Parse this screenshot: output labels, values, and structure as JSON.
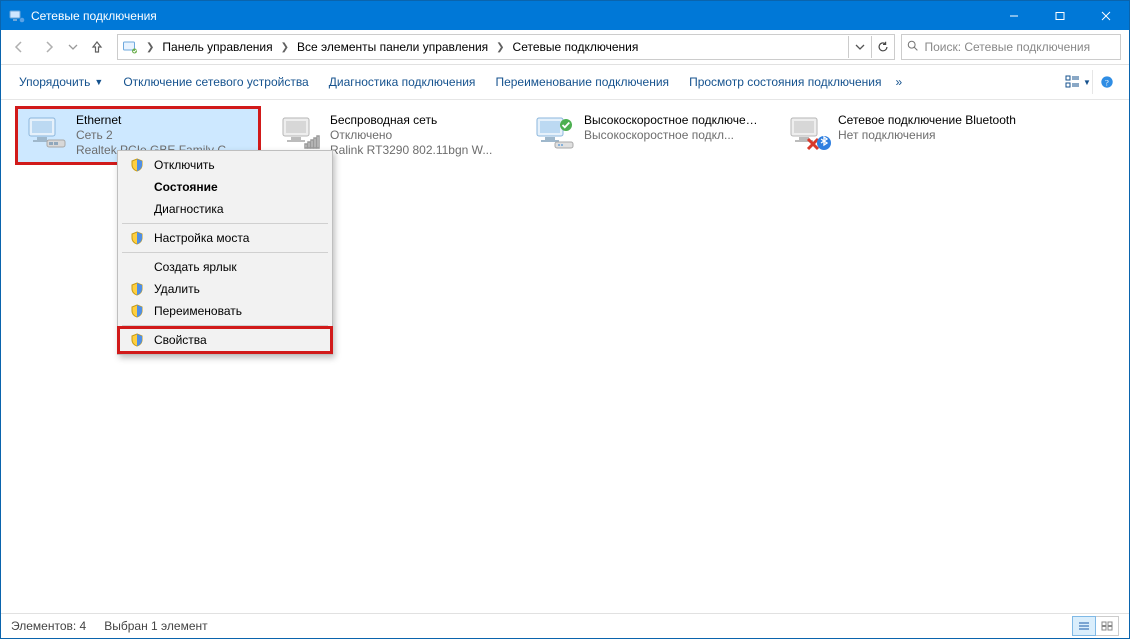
{
  "window": {
    "title": "Сетевые подключения"
  },
  "nav": {
    "back_enabled": false,
    "forward_enabled": false
  },
  "breadcrumb": {
    "segments": [
      "Панель управления",
      "Все элементы панели управления",
      "Сетевые подключения"
    ]
  },
  "search": {
    "placeholder": "Поиск: Сетевые подключения"
  },
  "toolbar": {
    "organize": "Упорядочить",
    "disable": "Отключение сетевого устройства",
    "diagnose": "Диагностика подключения",
    "rename": "Переименование подключения",
    "status": "Просмотр состояния подключения"
  },
  "connections": [
    {
      "name": "Ethernet",
      "line2": "Сеть  2",
      "line3": "Realtek PCIe GBE Family C...",
      "state": "connected",
      "selected": true,
      "highlight": true
    },
    {
      "name": "Беспроводная сеть",
      "line2": "Отключено",
      "line3": "Ralink RT3290 802.11bgn W...",
      "state": "wifi-off",
      "selected": false,
      "highlight": false
    },
    {
      "name": "Высокоскоростное подключение",
      "line2": "",
      "line3": "Высокоскоростное подкл...",
      "state": "broadband",
      "selected": false,
      "highlight": false
    },
    {
      "name": "Сетевое подключение Bluetooth",
      "line2": "",
      "line3": "Нет подключения",
      "state": "bluetooth-off",
      "selected": false,
      "highlight": false
    }
  ],
  "context_menu": {
    "items": [
      {
        "label": "Отключить",
        "icon": "shield",
        "bold": false
      },
      {
        "label": "Состояние",
        "icon": "",
        "bold": true
      },
      {
        "label": "Диагностика",
        "icon": "",
        "bold": false
      },
      {
        "sep": true
      },
      {
        "label": "Настройка моста",
        "icon": "shield",
        "bold": false
      },
      {
        "sep": true
      },
      {
        "label": "Создать ярлык",
        "icon": "",
        "bold": false
      },
      {
        "label": "Удалить",
        "icon": "shield",
        "bold": false
      },
      {
        "label": "Переименовать",
        "icon": "shield",
        "bold": false
      },
      {
        "sep": true
      },
      {
        "label": "Свойства",
        "icon": "shield",
        "bold": false,
        "boxed": true
      }
    ]
  },
  "status": {
    "count_label": "Элементов: 4",
    "selection_label": "Выбран 1 элемент"
  }
}
